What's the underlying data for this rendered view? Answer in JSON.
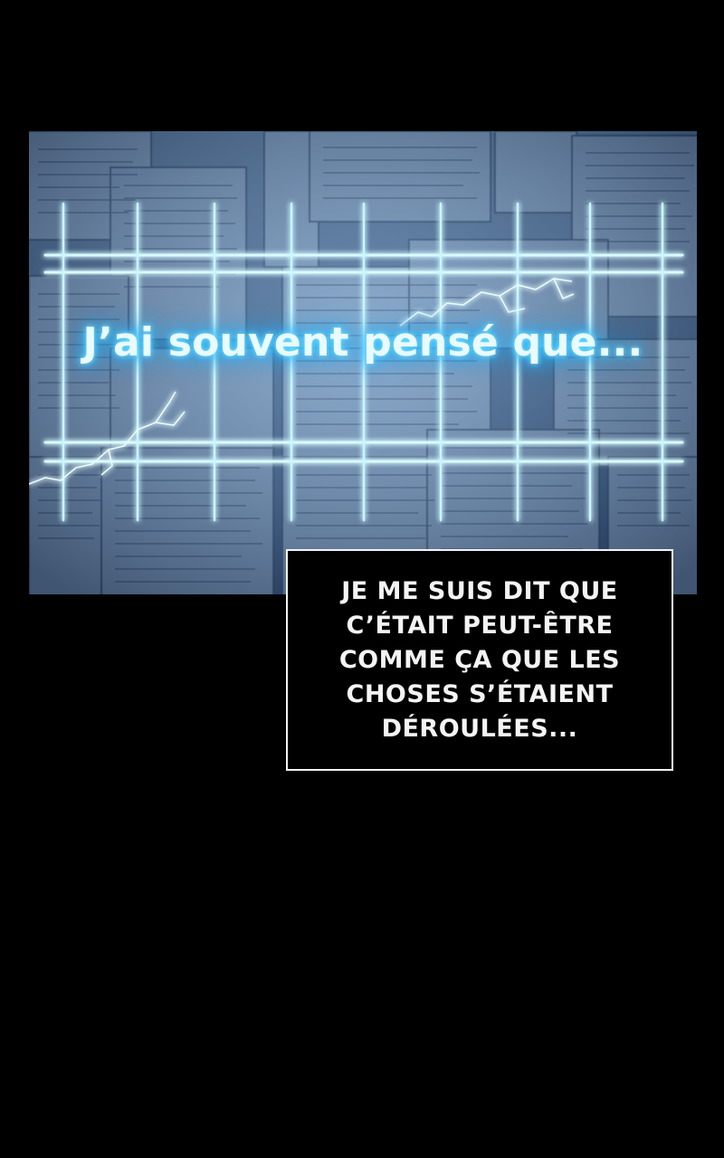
{
  "panel": {
    "title": "J’ai souvent pensé que..."
  },
  "caption": {
    "lines": [
      "JE ME SUIS DIT QUE",
      "C’ÉTAIT PEUT-ÊTRE",
      "COMME ÇA QUE LES",
      "CHOSES S’ÉTAIENT",
      "DÉROULÉES..."
    ]
  },
  "colors": {
    "background": "#000000",
    "glow": "#39c7ff",
    "caption_border": "#f2f2f2",
    "caption_text": "#f4f4f4"
  }
}
